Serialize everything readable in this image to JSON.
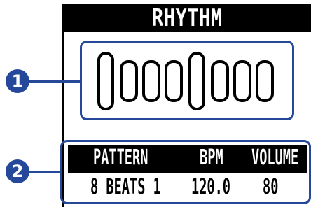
{
  "screen": {
    "title": "RHYTHM"
  },
  "beats": {
    "pattern_marks": [
      "accent",
      "normal",
      "normal",
      "normal",
      "accent",
      "normal",
      "normal",
      "normal"
    ]
  },
  "info": {
    "headers": [
      "PATTERN",
      "BPM",
      "VOLUME"
    ],
    "pattern_value": "8 BEATS 1",
    "bpm_value": "120.0",
    "volume_value": "80"
  },
  "callouts": [
    "1",
    "2"
  ],
  "colors": {
    "callout": "#25489a",
    "display_bg": "#000000",
    "display_text": "#ffffff"
  }
}
